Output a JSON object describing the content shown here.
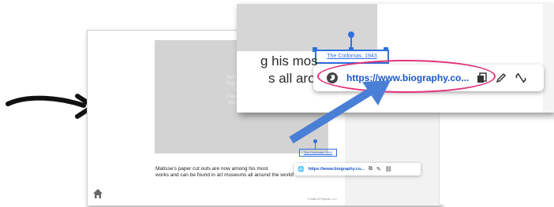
{
  "slide": {
    "placeholder_lines": [
      "For Education",
      "Purposes Onl",
      "",
      "Teacher",
      "Copy/Insert Im",
      "linked below"
    ],
    "caption": "The Codomas, 1943",
    "link_url": "https://www.biography.co...",
    "body_line1": "Matisse's paper cut outs are now among his most",
    "body_line2": "works and can be found in art museums all around the world!",
    "credit": "© Katie M Projects, LLC"
  },
  "zoom": {
    "caption": "The Codomas, 1943",
    "text_line1": "g his mos",
    "text_line2": "s all around the worl",
    "link_url": "https://www.biography.co..."
  },
  "icons": {
    "globe": "globe-icon",
    "copy": "copy-icon",
    "edit": "edit-icon",
    "unlink": "unlink-icon",
    "home": "home-icon"
  },
  "colors": {
    "accent_blue": "#2f6fe0",
    "link_blue": "#1a57c8",
    "highlight_pink": "#e0337a",
    "arrow_blue": "#4a7fd6"
  }
}
